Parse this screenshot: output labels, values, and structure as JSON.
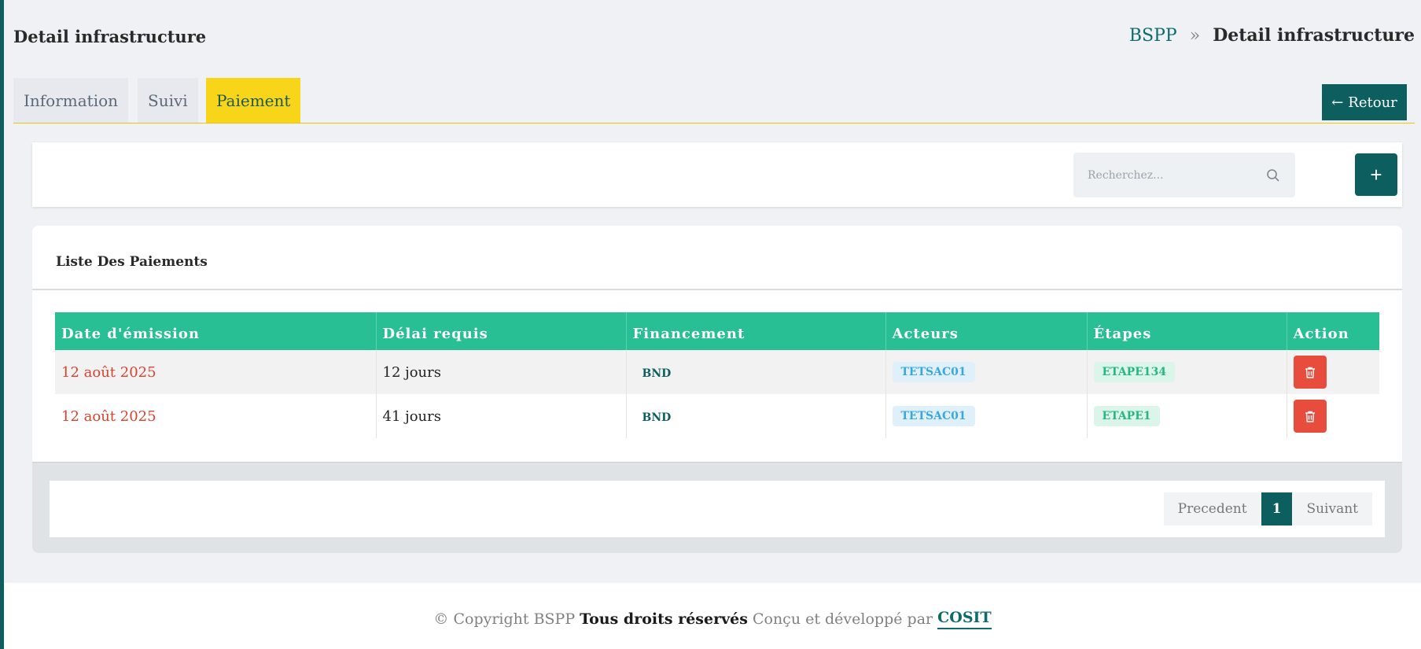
{
  "header": {
    "title": "Detail infrastructure",
    "breadcrumb": {
      "root": "BSPP",
      "separator": "»",
      "current": "Detail infrastructure"
    }
  },
  "tabs": [
    {
      "label": "Information",
      "active": false
    },
    {
      "label": "Suivi",
      "active": false
    },
    {
      "label": "Paiement",
      "active": true
    }
  ],
  "retour": {
    "arrow": "←",
    "label": "Retour"
  },
  "search": {
    "placeholder": "Recherchez...",
    "value": ""
  },
  "add_button": {
    "label": "+"
  },
  "list": {
    "title": "Liste Des Paiements",
    "columns": [
      "Date d'émission",
      "Délai requis",
      "Financement",
      "Acteurs",
      "Étapes",
      "Action"
    ],
    "rows": [
      {
        "date": "12 août 2025",
        "delai": "12 jours",
        "financement": "BND",
        "acteur": "TETSAC01",
        "etape": "ETAPE134"
      },
      {
        "date": "12 août 2025",
        "delai": "41 jours",
        "financement": "BND",
        "acteur": "TETSAC01",
        "etape": "ETAPE1"
      }
    ]
  },
  "pagination": {
    "prev": "Precedent",
    "current": "1",
    "next": "Suivant"
  },
  "footer": {
    "copyright": "© Copyright BSPP",
    "rights": "Tous droits réservés",
    "designed": "Conçu et développé par",
    "brand": "COSIT"
  },
  "colors": {
    "primary": "#0d5f5f",
    "tab_active": "#f9d51a",
    "table_header": "#27bf93",
    "danger": "#e74c3c",
    "date_text": "#d9432e"
  },
  "icons": {
    "search": "search-icon",
    "delete": "trash-icon",
    "separator": "double-chevron-right-icon"
  }
}
